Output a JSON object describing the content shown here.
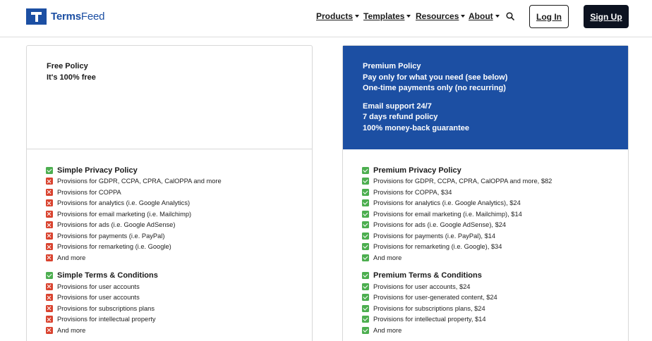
{
  "brand": {
    "name_bold": "Terms",
    "name_light": "Feed"
  },
  "nav": {
    "products": "Products",
    "templates": "Templates",
    "resources": "Resources",
    "about": "About"
  },
  "auth": {
    "login": "Log In",
    "signup": "Sign Up"
  },
  "free": {
    "head": [
      "Free Policy",
      "It's 100% free"
    ],
    "sections": [
      {
        "title": "Simple Privacy Policy",
        "title_status": "yes",
        "items": [
          {
            "text": "Provisions for GDPR, CCPA, CPRA, CalOPPA and more",
            "status": "no"
          },
          {
            "text": "Provisions for COPPA",
            "status": "no"
          },
          {
            "text": "Provisions for analytics (i.e. Google Analytics)",
            "status": "no"
          },
          {
            "text": "Provisions for email marketing (i.e. Mailchimp)",
            "status": "no"
          },
          {
            "text": "Provisions for ads (i.e. Google AdSense)",
            "status": "no"
          },
          {
            "text": "Provisions for payments (i.e. PayPal)",
            "status": "no"
          },
          {
            "text": "Provisions for remarketing (i.e. Google)",
            "status": "no"
          },
          {
            "text": "And more",
            "status": "no"
          }
        ]
      },
      {
        "title": "Simple Terms & Conditions",
        "title_status": "yes",
        "items": [
          {
            "text": "Provisions for user accounts",
            "status": "no"
          },
          {
            "text": "Provisions for user accounts",
            "status": "no"
          },
          {
            "text": "Provisions for subscriptions plans",
            "status": "no"
          },
          {
            "text": "Provisions for intellectual property",
            "status": "no"
          },
          {
            "text": "And more",
            "status": "no"
          }
        ]
      }
    ]
  },
  "premium": {
    "head": [
      "Premium Policy",
      "Pay only for what you need (see below)",
      "One-time payments only (no recurring)"
    ],
    "head2": [
      "Email support 24/7",
      "7 days refund policy",
      "100% money-back guarantee"
    ],
    "sections": [
      {
        "title": "Premium Privacy Policy",
        "title_status": "yes",
        "items": [
          {
            "text": "Provisions for GDPR, CCPA, CPRA, CalOPPA and more, $82",
            "status": "yes"
          },
          {
            "text": "Provisions for COPPA, $34",
            "status": "yes"
          },
          {
            "text": "Provisions for analytics (i.e. Google Analytics), $24",
            "status": "yes"
          },
          {
            "text": "Provisions for email marketing (i.e. Mailchimp), $14",
            "status": "yes"
          },
          {
            "text": "Provisions for ads (i.e. Google AdSense), $24",
            "status": "yes"
          },
          {
            "text": "Provisions for payments (i.e. PayPal), $14",
            "status": "yes"
          },
          {
            "text": "Provisions for remarketing (i.e. Google), $34",
            "status": "yes"
          },
          {
            "text": "And more",
            "status": "yes"
          }
        ]
      },
      {
        "title": "Premium Terms & Conditions",
        "title_status": "yes",
        "items": [
          {
            "text": "Provisions for user accounts, $24",
            "status": "yes"
          },
          {
            "text": "Provisions for user-generated content, $24",
            "status": "yes"
          },
          {
            "text": "Provisions for subscriptions plans, $24",
            "status": "yes"
          },
          {
            "text": "Provisions for intellectual property, $14",
            "status": "yes"
          },
          {
            "text": "And more",
            "status": "yes"
          }
        ]
      }
    ]
  },
  "colors": {
    "brand": "#1c4fa3",
    "check": "#4cae4f",
    "cross": "#d9432f",
    "signup_bg": "#0c1220"
  },
  "icons": {
    "check": "check-icon",
    "cross": "cross-icon",
    "search": "search-icon",
    "caret": "chevron-down-icon"
  }
}
